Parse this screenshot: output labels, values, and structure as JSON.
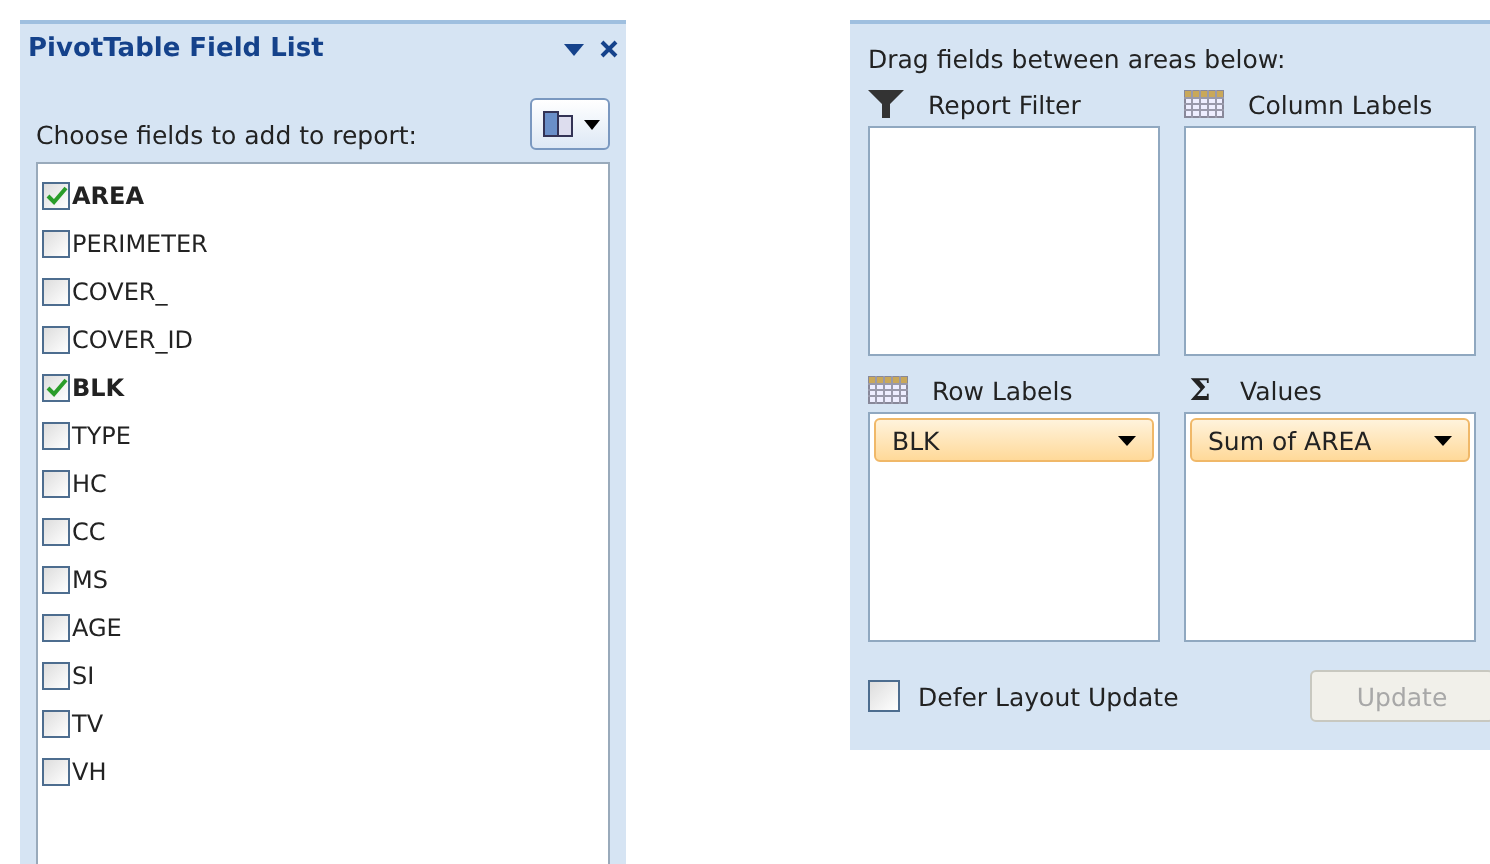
{
  "field_list": {
    "title": "PivotTable Field List",
    "prompt": "Choose fields to add to report:",
    "fields": [
      {
        "label": "AREA",
        "checked": true
      },
      {
        "label": "PERIMETER",
        "checked": false
      },
      {
        "label": "COVER_",
        "checked": false
      },
      {
        "label": "COVER_ID",
        "checked": false
      },
      {
        "label": "BLK",
        "checked": true
      },
      {
        "label": "TYPE",
        "checked": false
      },
      {
        "label": "HC",
        "checked": false
      },
      {
        "label": "CC",
        "checked": false
      },
      {
        "label": "MS",
        "checked": false
      },
      {
        "label": "AGE",
        "checked": false
      },
      {
        "label": "SI",
        "checked": false
      },
      {
        "label": "TV",
        "checked": false
      },
      {
        "label": "VH",
        "checked": false
      }
    ]
  },
  "areas_panel": {
    "instruction": "Drag fields between areas below:",
    "areas": [
      {
        "kind": "filter",
        "label": "Report Filter"
      },
      {
        "kind": "grid",
        "label": "Column Labels"
      },
      {
        "kind": "grid",
        "label": "Row Labels",
        "items": [
          "BLK"
        ]
      },
      {
        "kind": "sigma",
        "icon": "Σ",
        "label": "Values",
        "items": [
          "Sum of AREA"
        ]
      }
    ],
    "defer": {
      "label": "Defer Layout Update",
      "checked": false
    },
    "update_button": {
      "label": "Update",
      "disabled": true
    }
  }
}
